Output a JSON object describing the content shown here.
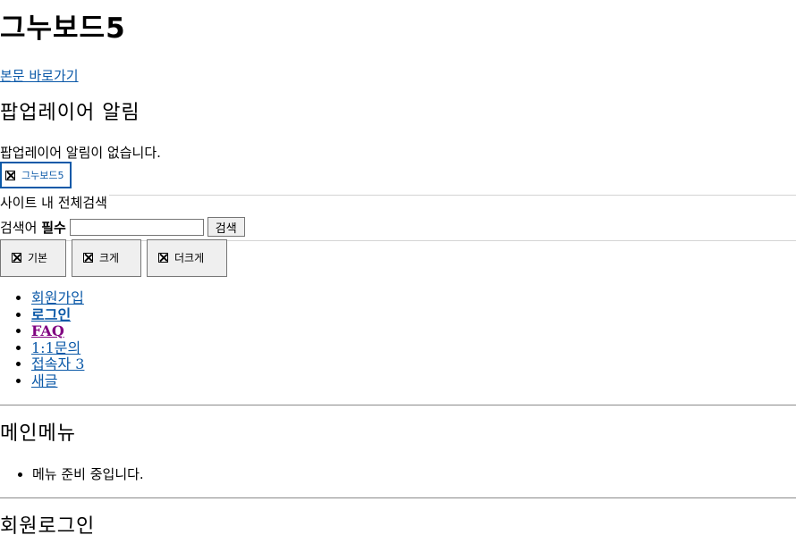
{
  "site": {
    "title": "그누보드5",
    "skip_link": "본문 바로가기"
  },
  "popup": {
    "heading": "팝업레이어 알림",
    "empty_message": "팝업레이어 알림이 없습니다."
  },
  "logo": {
    "alt": "그누보드5",
    "icon": "broken-image-icon"
  },
  "search": {
    "legend": "사이트 내 전체검색",
    "label": "검색어",
    "required": "필수",
    "input_value": "",
    "button_label": "검색"
  },
  "font_size": {
    "buttons": [
      {
        "label": "기본",
        "icon": "broken-image-icon"
      },
      {
        "label": "크게",
        "icon": "broken-image-icon"
      },
      {
        "label": "더크게",
        "icon": "broken-image-icon"
      }
    ]
  },
  "user_menu": {
    "items": [
      {
        "label": "회원가입"
      },
      {
        "label": "로그인"
      },
      {
        "label": "FAQ"
      },
      {
        "label": "1:1문의"
      },
      {
        "label": "접속자 3"
      },
      {
        "label": "새글"
      }
    ]
  },
  "main_menu": {
    "heading": "메인메뉴",
    "items": [
      {
        "label": "메뉴 준비 중입니다."
      }
    ]
  },
  "login": {
    "heading": "회원로그인"
  },
  "colors": {
    "link": "#0b59a8",
    "visited_link": "#800080",
    "divider": "#8a8a8a"
  }
}
